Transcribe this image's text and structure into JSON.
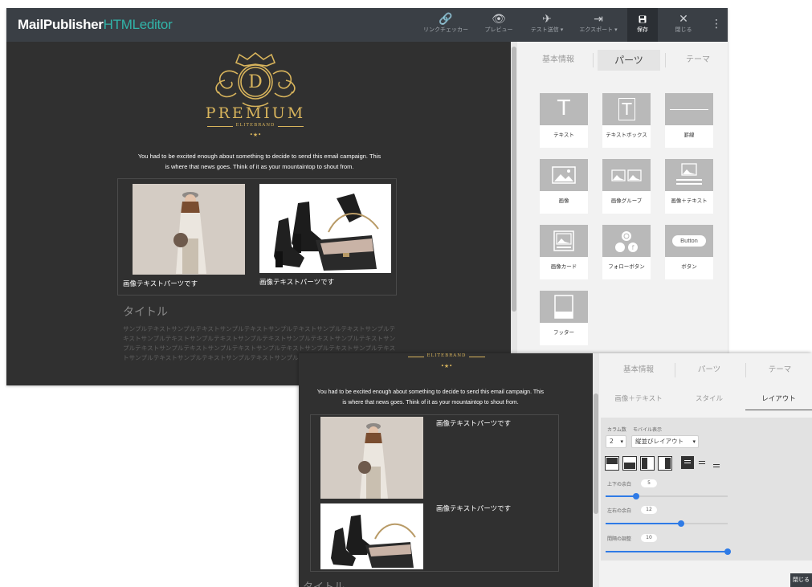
{
  "app": {
    "logo_main": "MailPublisher",
    "logo_accent": "HTMLeditor"
  },
  "toolbar": {
    "link_checker": "リンクチェッカー",
    "preview": "プレビュー",
    "test_send": "テスト送信 ▾",
    "export": "エクスポート ▾",
    "save": "保存",
    "close": "閉じる"
  },
  "brand": {
    "letter": "D",
    "name": "PREMIUM",
    "sub": "ELITEBRAND"
  },
  "email": {
    "intro_line1": "You had to be excited enough about something to decide to send this email campaign. This",
    "intro_line2": "is where that news goes. Think of it as your mountaintop to shout from.",
    "caption1": "画像テキストパーツです",
    "caption2": "画像テキストパーツです",
    "title": "タイトル",
    "sample_text": "サンプルテキストサンプルテキストサンプルテキストサンプルテキストサンプルテキストサンプルテキストサンプルテキストサンプルテキストサンプルテキストサンプルテキストサンプルテキストサンプルテキストサンプルテキストサンプルテキストサンプルテキストサンプルテキストサンプルテキストサンプルテキストサンプルテキストサンプルテキストサンプルテキスト"
  },
  "panel": {
    "tabs": [
      "基本情報",
      "パーツ",
      "テーマ"
    ],
    "parts": [
      {
        "label": "テキスト",
        "icon": "text-icon"
      },
      {
        "label": "テキストボックス",
        "icon": "text-box-icon"
      },
      {
        "label": "罫線",
        "icon": "divider-line-icon"
      },
      {
        "label": "画像",
        "icon": "image-icon"
      },
      {
        "label": "画像グループ",
        "icon": "image-group-icon"
      },
      {
        "label": "画像＋テキスト",
        "icon": "image-text-icon"
      },
      {
        "label": "画像カード",
        "icon": "image-card-icon"
      },
      {
        "label": "フォローボタン",
        "icon": "social-follow-icon"
      },
      {
        "label": "ボタン",
        "icon": "button-icon"
      },
      {
        "label": "フッター",
        "icon": "footer-icon"
      }
    ],
    "button_tile_text": "Button"
  },
  "panel2": {
    "tabs": [
      "基本情報",
      "パーツ",
      "テーマ"
    ],
    "subtabs": [
      "画像＋テキスト",
      "スタイル",
      "レイアウト"
    ],
    "columns_label": "カラム数",
    "columns_value": "2",
    "mobile_label": "モバイル表示",
    "mobile_value": "縦並びレイアウト",
    "vertical_margin_label": "上下の余白",
    "vertical_margin_value": "5",
    "horizontal_margin_label": "左右の余白",
    "horizontal_margin_value": "12",
    "spacing_label": "間隔の調整",
    "spacing_value": "10",
    "close_label": "閉じる"
  },
  "colors": {
    "accent": "#31b4a9",
    "editor_bg": "#303030",
    "gold": "#d8b45c",
    "slider": "#2f7be6"
  }
}
